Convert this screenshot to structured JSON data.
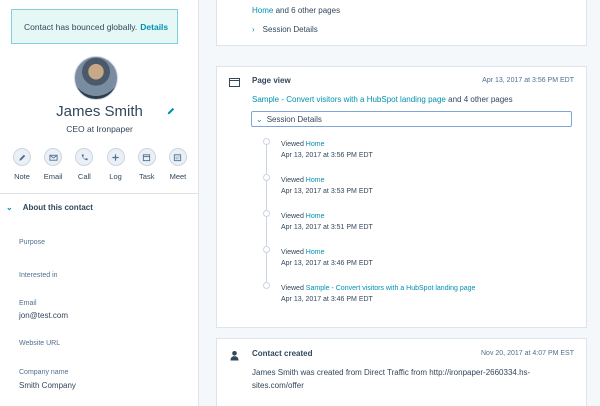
{
  "alert": {
    "text": "Contact has bounced globally.",
    "link": "Details"
  },
  "contact": {
    "name": "James Smith",
    "title": "CEO at Ironpaper"
  },
  "actions": [
    {
      "label": "Note",
      "icon": "note-icon"
    },
    {
      "label": "Email",
      "icon": "email-icon"
    },
    {
      "label": "Call",
      "icon": "call-icon"
    },
    {
      "label": "Log",
      "icon": "log-icon"
    },
    {
      "label": "Task",
      "icon": "task-icon"
    },
    {
      "label": "Meet",
      "icon": "meet-icon"
    }
  ],
  "about": {
    "heading": "About this contact",
    "properties": [
      {
        "label": "Purpose",
        "value": ""
      },
      {
        "label": "Interested in",
        "value": ""
      },
      {
        "label": "Email",
        "value": "jon@test.com"
      },
      {
        "label": "Website URL",
        "value": ""
      },
      {
        "label": "Company name",
        "value": "Smith Company"
      }
    ]
  },
  "card1": {
    "pages_link": "Home",
    "pages_rest": "and 6 other pages",
    "session_label": "Session Details"
  },
  "card2": {
    "title": "Page view",
    "date": "Apr 13, 2017 at 3:56 PM EDT",
    "page_link": "Sample - Convert visitors with a HubSpot landing page",
    "page_rest": "and 4 other pages",
    "session_label": "Session Details",
    "timeline": [
      {
        "prefix": "Viewed",
        "page": "Home",
        "date": "Apr 13, 2017 at 3:56 PM EDT"
      },
      {
        "prefix": "Viewed",
        "page": "Home",
        "date": "Apr 13, 2017 at 3:53 PM EDT"
      },
      {
        "prefix": "Viewed",
        "page": "Home",
        "date": "Apr 13, 2017 at 3:51 PM EDT"
      },
      {
        "prefix": "Viewed",
        "page": "Home",
        "date": "Apr 13, 2017 at 3:46 PM EDT"
      },
      {
        "prefix": "Viewed",
        "page": "Sample - Convert visitors with a HubSpot landing page",
        "date": "Apr 13, 2017 at 3:46 PM EDT"
      }
    ]
  },
  "card3": {
    "title": "Contact created",
    "date": "Nov 20, 2017 at 4:07 PM EST",
    "body_line1": "James Smith was created from Direct Traffic from http://ironpaper-2660334.hs-",
    "body_line2": "sites.com/offer"
  },
  "colors": {
    "link": "#0091ae",
    "text": "#33475b",
    "alert_border": "#7fd1de",
    "focus_border": "#7ea7d8"
  }
}
